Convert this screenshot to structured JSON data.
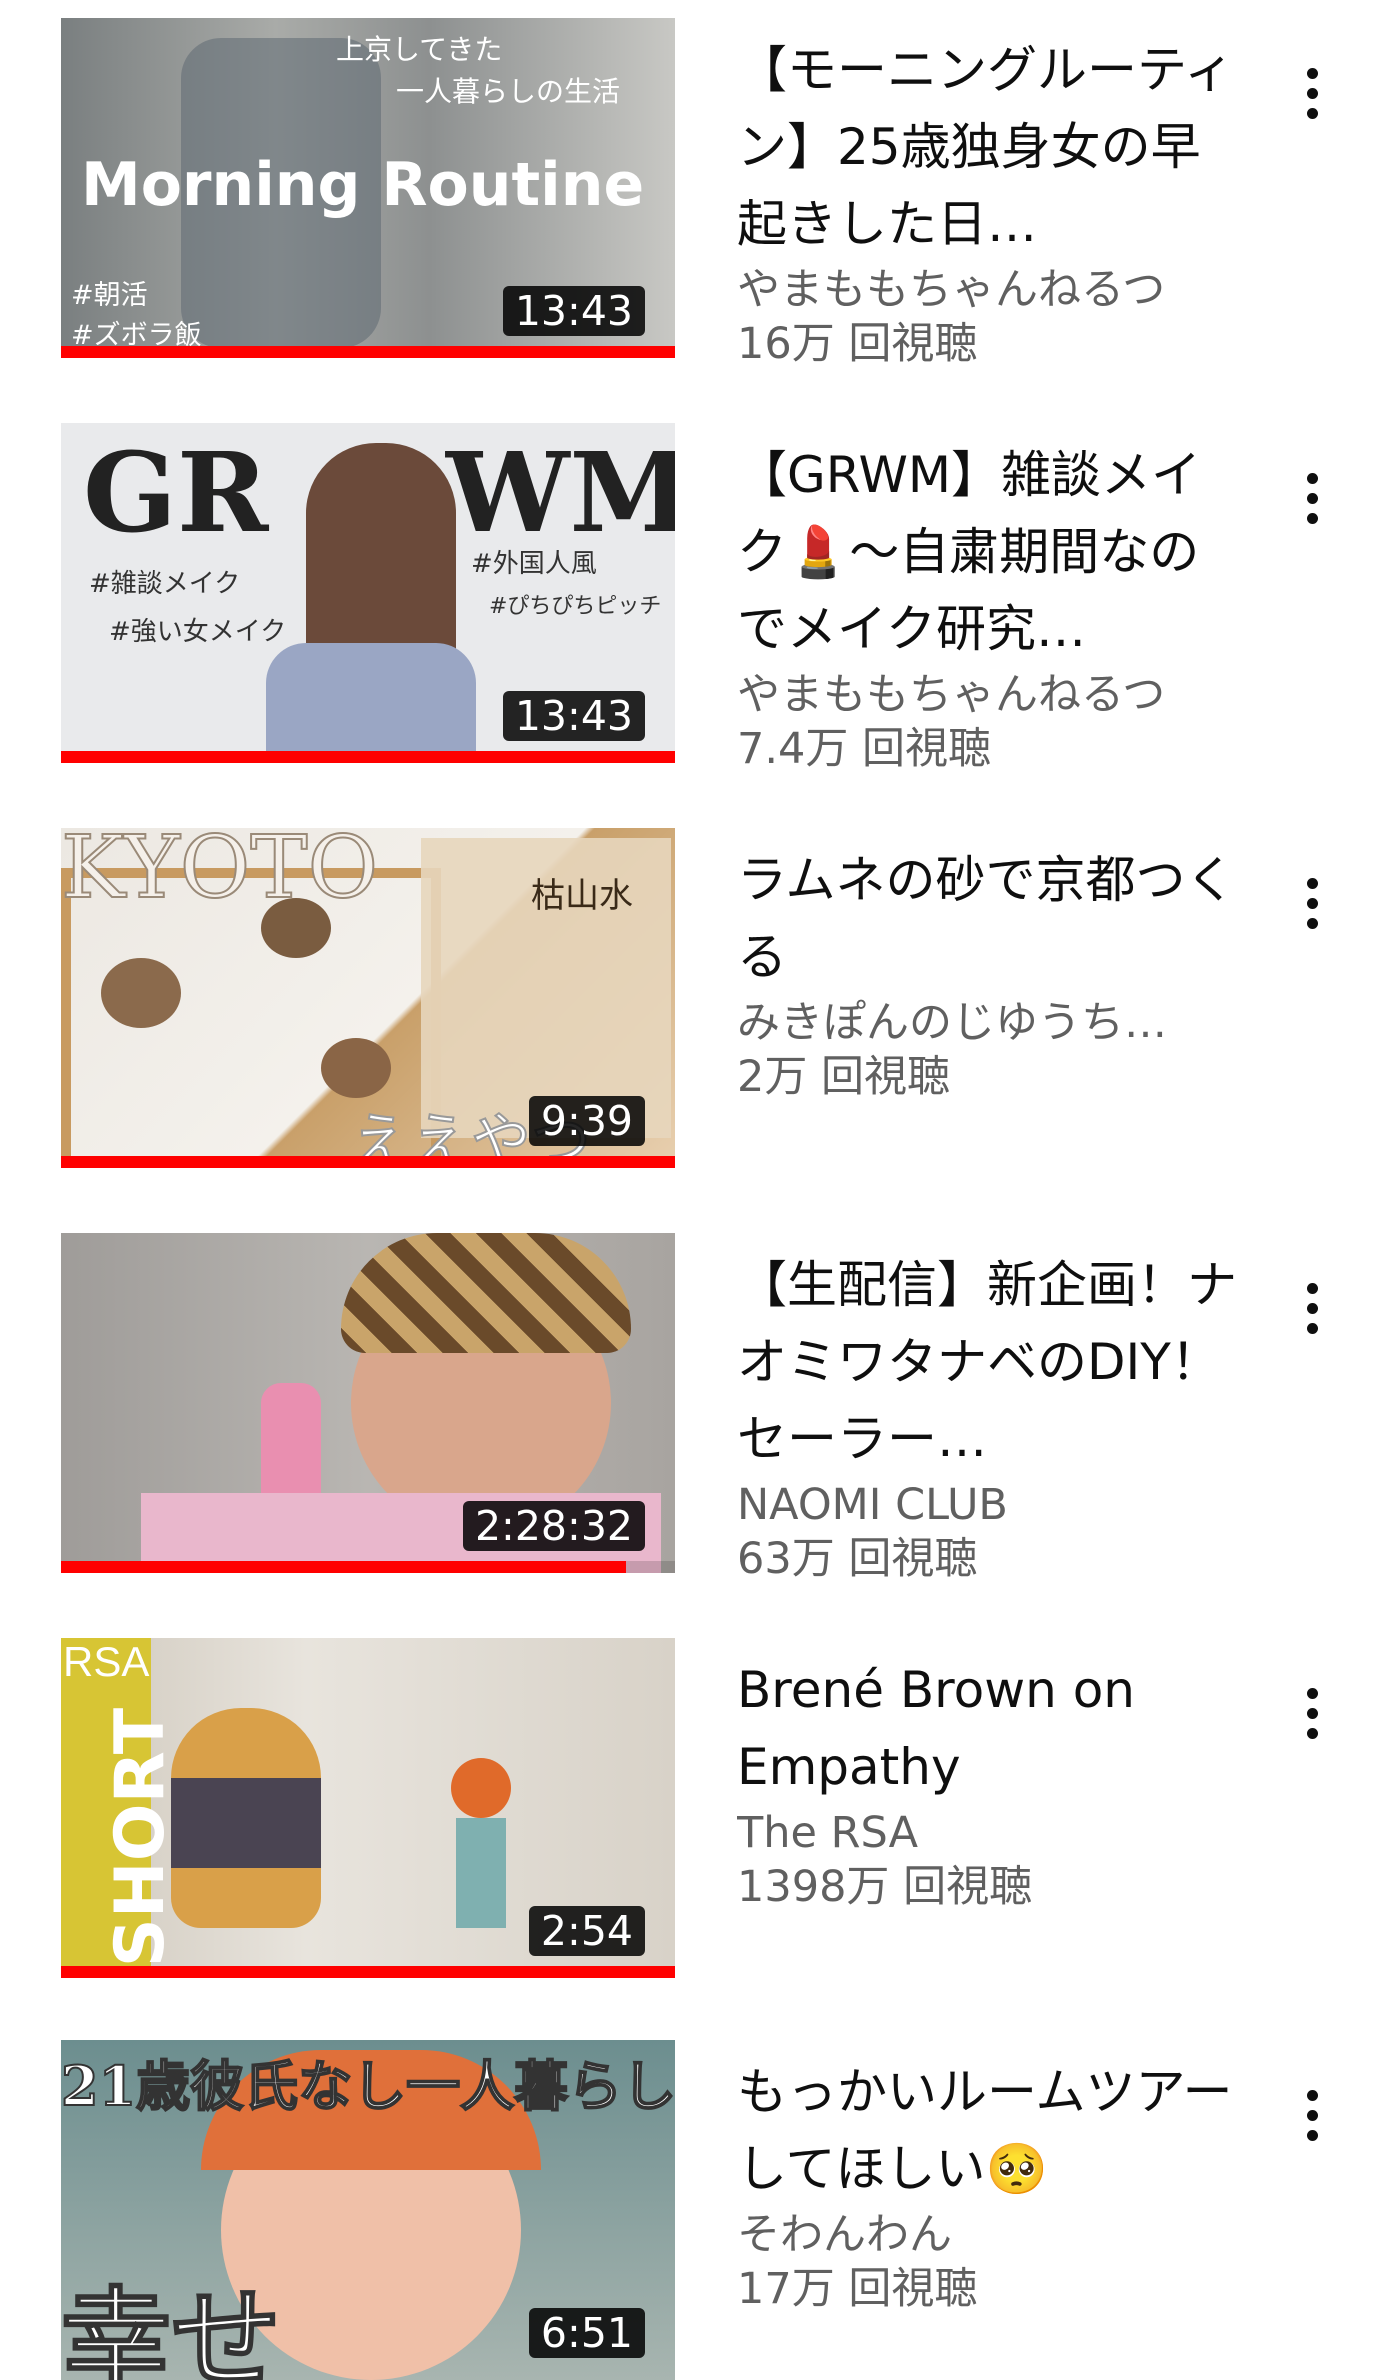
{
  "videos": [
    {
      "title": "【モーニングルーティン】25歳独身女の早起きした日…",
      "channel": "やまももちゃんねるつ",
      "views": "16万 回視聴",
      "duration": "13:43",
      "progress": 1.0,
      "thumb_text": {
        "line1": "上京してきた",
        "line2": "一人暮らしの生活",
        "big": "Morning Routine",
        "tag1": "#朝活",
        "tag2": "#ズボラ飯"
      }
    },
    {
      "title": "【GRWM】雑談メイク💄～自粛期間なのでメイク研究…",
      "channel": "やまももちゃんねるつ",
      "views": "7.4万 回視聴",
      "duration": "13:43",
      "progress": 1.0,
      "thumb_text": {
        "left_big": "GR",
        "right_big": "WM",
        "tag1": "#雑談メイク",
        "tag2": "#強い女メイク",
        "tag3": "#外国人風",
        "tag4": "#ぴちぴちピッチ"
      }
    },
    {
      "title": "ラムネの砂で京都つくる",
      "channel": "みきぽんのじゆうち…",
      "views": "2万 回視聴",
      "duration": "9:39",
      "progress": 1.0,
      "thumb_text": {
        "big": "KYOTO",
        "kanji": "枯山水",
        "bottom": "ええやつ"
      }
    },
    {
      "title": "【生配信】新企画！ナオミワタナベのDIY！セーラー…",
      "channel": "NAOMI CLUB",
      "views": "63万 回視聴",
      "duration": "2:28:32",
      "progress": 0.92,
      "thumb_text": {}
    },
    {
      "title": "Brené Brown on Empathy",
      "channel": "The RSA",
      "views": "1398万 回視聴",
      "duration": "2:54",
      "progress": 1.0,
      "thumb_text": {
        "brand": "RSA",
        "side": "SHORT"
      }
    },
    {
      "title": "もっかいルームツアーしてほしい🥺",
      "channel": "そわんわん",
      "views": "17万 回視聴",
      "duration": "6:51",
      "progress": 0,
      "thumb_text": {
        "big": "21歳彼氏なし一人暮らし",
        "bottom": "幸せ"
      }
    }
  ]
}
